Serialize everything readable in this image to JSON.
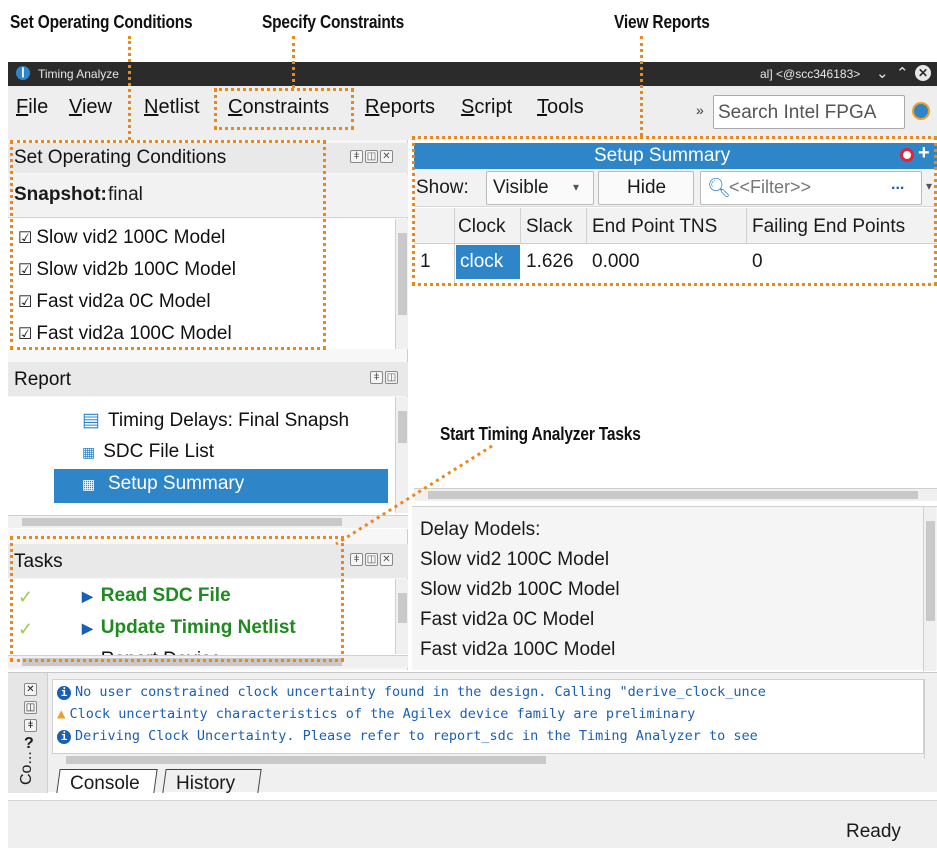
{
  "callouts": {
    "set_operating_conditions": "Set Operating Conditions",
    "specify_constraints": "Specify Constraints",
    "view_reports": "View Reports",
    "start_tasks": "Start Timing Analyzer Tasks"
  },
  "window": {
    "title": "Timing Analyze",
    "title_right": "al] <@scc346183>"
  },
  "menu": {
    "items": [
      "File",
      "View",
      "Netlist",
      "Constraints",
      "Reports",
      "Script",
      "Tools"
    ],
    "chevron": "»",
    "search_placeholder": "Search Intel FPGA"
  },
  "op_conditions": {
    "title": "Set Operating Conditions",
    "snapshot_label": "Snapshot:",
    "snapshot_value": "final",
    "models": [
      "Slow vid2 100C Model",
      "Slow vid2b 100C Model",
      "Fast vid2a 0C Model",
      "Fast vid2a 100C Model"
    ]
  },
  "report": {
    "title": "Report",
    "items": [
      "Timing Delays: Final Snapsh",
      "SDC File List",
      "Setup Summary"
    ],
    "selected_index": 2
  },
  "tasks": {
    "title": "Tasks",
    "items": [
      "Read SDC File",
      "Update Timing Netlist"
    ],
    "partial_item": "Report Device"
  },
  "setup_summary": {
    "title": "Setup Summary",
    "show_label": "Show:",
    "show_value": "Visible",
    "hide_label": "Hide",
    "filter_placeholder": "<<Filter>>",
    "more": "...",
    "columns": [
      "Clock",
      "Slack",
      "End Point TNS",
      "Failing End Points"
    ],
    "rows": [
      {
        "index": "1",
        "clock": "clock",
        "slack": "1.626",
        "tns": "0.000",
        "failing": "0"
      }
    ]
  },
  "delay_models": {
    "heading": "Delay Models:",
    "items": [
      "Slow vid2 100C Model",
      "Slow vid2b 100C Model",
      "Fast vid2a 0C Model",
      "Fast vid2a 100C Model"
    ]
  },
  "console": {
    "messages": [
      {
        "type": "info",
        "text": "No user constrained clock uncertainty found in the design. Calling \"derive_clock_unce"
      },
      {
        "type": "warning",
        "text": "Clock uncertainty characteristics of the Agilex device family are preliminary"
      },
      {
        "type": "info",
        "text": "Deriving Clock Uncertainty. Please refer to report_sdc in the Timing Analyzer to see"
      }
    ],
    "side_label": "Co...",
    "help": "?",
    "tabs": [
      "Console",
      "History"
    ]
  },
  "status": {
    "text": "Ready"
  },
  "colors": {
    "callout_border": "#e8891c",
    "title_blue": "#2e86c8",
    "selection_blue": "#2e86c8",
    "task_green": "#1f8a1f",
    "info_blue": "#1a5fb4",
    "warning_orange": "#f0a020"
  }
}
